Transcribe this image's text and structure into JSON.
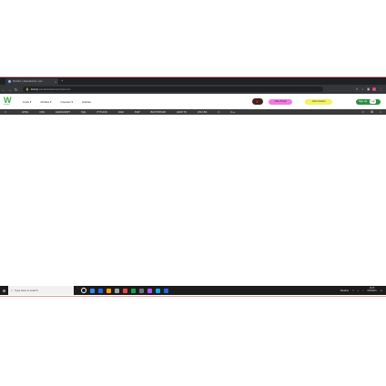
{
  "browser": {
    "tab_title": "Pinclaro | dastudentrec .com",
    "tab_close": "×",
    "new_tab": "+",
    "back": "←",
    "forward": "→",
    "reload": "↻",
    "lock": "🔒",
    "url_domain": "dstudy",
    "url_path": ".com/dastudentrec/reference",
    "toolbar_icons": [
      "share-icon",
      "star-icon",
      "extensions-icon"
    ]
  },
  "site": {
    "logo_letter": "W",
    "logo_sub": "wisdom",
    "menu": [
      "Links ▾",
      "Articles ▾",
      "Courses ▾",
      "Articles"
    ],
    "dark_button": "☾",
    "pink_button": "Jobs Portal",
    "yellow_button": "Jobs Fresher",
    "green_button": "Sign Up",
    "green_toggle": "Log"
  },
  "categories": [
    "HTML",
    "CSS",
    "JAVASCRIPT",
    "SQL",
    "PYTHON",
    "JAVA",
    "PHP",
    "BOOTSTRAP",
    "HOW TO",
    "W3.CSS",
    "C",
    "C++"
  ],
  "category_right_icons": [
    "◐",
    "⚙",
    "⌕"
  ],
  "taskbar": {
    "start": "⊞",
    "search_placeholder": "Type here to search",
    "tray_text": "Weather",
    "time": "10:45",
    "date": "3/10/2021",
    "icon_colors": [
      "#ffffff",
      "#3b82f6",
      "#2563eb",
      "#f59e0b",
      "#9ca3af",
      "#ef4444",
      "#16a34a",
      "#6b7280",
      "#a855f7",
      "#0ea5e9",
      "#2563eb"
    ]
  }
}
